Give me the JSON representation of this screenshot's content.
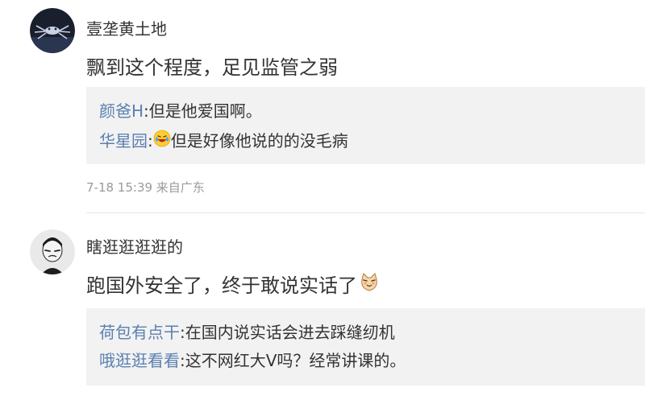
{
  "comments": [
    {
      "avatar_icon": "dark-sea-creature-avatar-icon",
      "username": "壹垄黄土地",
      "text": "飘到这个程度，足见监管之弱",
      "replies": [
        {
          "user": "颜爸H",
          "sep": ":",
          "emoji": "",
          "text": "但是他爱国啊。"
        },
        {
          "user": "华星园",
          "sep": ":",
          "emoji": "laughing-tears-emoji-icon",
          "text": "但是好像他说的的没毛病"
        }
      ],
      "meta": "7-18 15:39 来自广东"
    },
    {
      "avatar_icon": "masked-figure-avatar-icon",
      "username": "瞎逛逛逛逛的",
      "text": "跑国外安全了，终于敢说实话了",
      "text_emoji": "cat-face-emoji-icon",
      "replies": [
        {
          "user": "荷包有点干",
          "sep": ":",
          "emoji": "",
          "text": "在国内说实话会进去踩缝纫机"
        },
        {
          "user": "哦逛逛看看",
          "sep": ":",
          "emoji": "",
          "text": "这不网红大V吗？经常讲课的。"
        }
      ]
    }
  ],
  "colors": {
    "reply_user": "#5b7fb0",
    "meta": "#9a9a9a",
    "reply_bg": "#f2f2f2"
  }
}
